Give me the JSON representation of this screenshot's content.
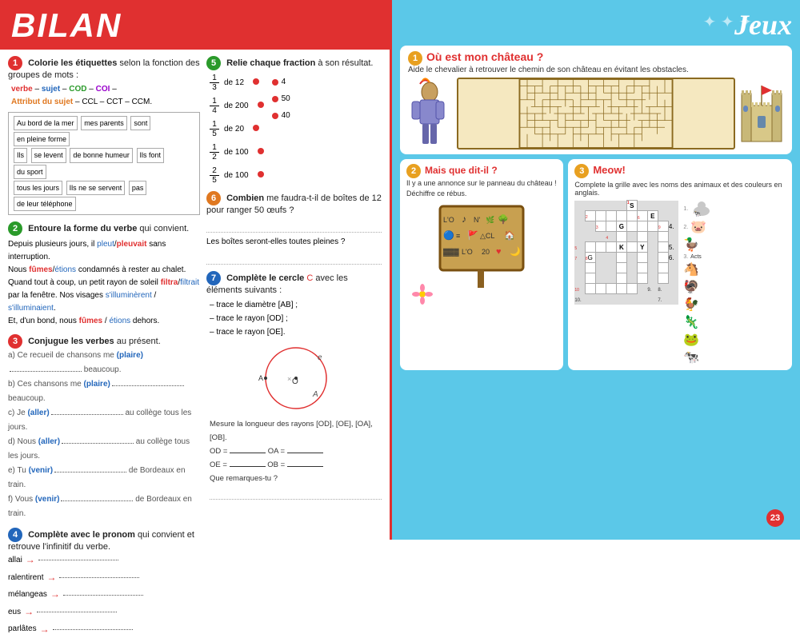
{
  "left": {
    "title": "BILAN",
    "ex1": {
      "number": "1",
      "instruction": "Colorie les étiquettes selon la fonction des groupes de mots :",
      "colors": "verbe – sujet – COD – COI – Attribut du sujet – CCL – CCT – CCM.",
      "sentences": [
        [
          "Au bord de la mer",
          "mes parents",
          "sont",
          "en pleine forme"
        ],
        [
          "Ils",
          "se levent",
          "de bonne humeur",
          "Ils font",
          "du sport"
        ],
        [
          "tous les jours",
          "Ils ne se servent",
          "pas",
          "de leur téléphone"
        ]
      ]
    },
    "ex2": {
      "number": "2",
      "instruction": "Entoure la forme du verbe qui convient.",
      "lines": [
        "Depuis plusieurs jours, il pleut/pleuvait sans interruption.",
        "Nous fûmes/étions condamnés à rester au chalet.",
        "Quand tout à coup, un petit rayon de soleil filtra/filtrait",
        "par la fenêtre. Nos visages s'illuminèrent / s'illuminaient.",
        "Et, d'un bond, nous fûmes / étions dehors."
      ]
    },
    "ex3": {
      "number": "3",
      "instruction": "Conjugue les verbes au présent.",
      "items": [
        "a) Ce recueil de chansons me (plaire) _______ beaucoup.",
        "b) Ces chansons me (plaire) _______ beaucoup.",
        "c) Je (aller) _______ au collège tous les jours.",
        "d) Nous (aller) _______ au collège tous les jours.",
        "e) Tu (venir) _______ de Bordeaux en train.",
        "f) Vous (venir) _______ de Bordeaux en train."
      ]
    },
    "ex4": {
      "number": "4",
      "instruction": "Complète avec le pronom qui convient et retrouve l'infinitif du verbe.",
      "items": [
        "allai →",
        "ralentirent →",
        "mélangeas →",
        "eus →",
        "parlâtes →"
      ]
    }
  },
  "left_col2": {
    "ex5": {
      "number": "5",
      "instruction": "Relie chaque fraction à son résultat.",
      "fractions": [
        {
          "num": "1",
          "den": "3",
          "of": "de 12"
        },
        {
          "num": "1",
          "den": "4",
          "of": "de 200"
        },
        {
          "num": "1",
          "den": "5",
          "of": "de 20"
        },
        {
          "num": "1",
          "den": "2",
          "of": "de 100"
        },
        {
          "num": "2",
          "den": "5",
          "of": "de 100"
        }
      ],
      "results": [
        "4",
        "50",
        "40"
      ]
    },
    "ex6": {
      "number": "6",
      "instruction": "Combien me faudra-t-il de boîtes de 12 pour ranger 50 œufs ?",
      "question": "Les boîtes seront-elles toutes pleines ?"
    },
    "ex7": {
      "number": "7",
      "instruction": "Complète le cercle avec les éléments suivants :",
      "items": [
        "– trace le diamètre [AB] ;",
        "– trace le rayon [OD] ;",
        "– trace le rayon [OE]."
      ],
      "measurements": "Mesure la longueur des rayons [OD], [OE], [OA], [OB].",
      "lines": [
        "OD = ___     OA = ___",
        "OE = ___     OB = ___",
        "Que remarques-tu ?"
      ]
    }
  },
  "right": {
    "title": "Jeux",
    "ex1": {
      "number": "1",
      "title": "Où est mon château ?",
      "subtitle": "Aide le chevalier à retrouver le chemin de son château en évitant les obstacles."
    },
    "ex2": {
      "number": "2",
      "title": "Mais que dit-il ?",
      "subtitle": "Il y a une annonce sur le panneau du château ! Déchiffre ce rébus."
    },
    "ex3": {
      "number": "3",
      "title": "Meow!",
      "subtitle": "Complete la grille avec les noms des animaux et des couleurs en anglais."
    },
    "crossword": {
      "letters": {
        "r1c6": "S",
        "r2c4": "",
        "r2c8": "E",
        "r3c3": "",
        "r3c5": "G",
        "r4c7": "",
        "r5c5": "K",
        "r5c7": "Y",
        "r6c2": "G",
        "r7c6": "",
        "r8c4": "",
        "r9c3": "",
        "r10c5": ""
      }
    },
    "page_number": "23"
  }
}
